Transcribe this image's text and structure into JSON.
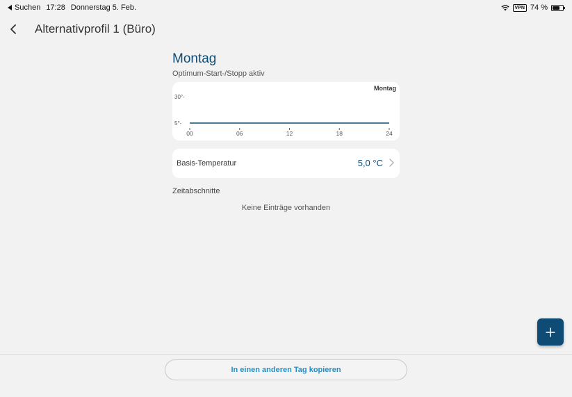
{
  "status_bar": {
    "back_app": "Suchen",
    "time": "17:28",
    "date": "Donnerstag 5. Feb.",
    "vpn": "VPN",
    "battery": "74 %",
    "battery_level": 0.74
  },
  "nav": {
    "title": "Alternativprofil 1 (Büro)",
    "back_icon": "chevron-left-icon"
  },
  "day": {
    "title": "Montag",
    "subtitle": "Optimum-Start-/Stopp aktiv"
  },
  "chart_data": {
    "type": "line",
    "title": "Montag",
    "y_ticks": [
      "30°-",
      "5°-"
    ],
    "y_tick_values": [
      30,
      5
    ],
    "x_ticks": [
      "00",
      "06",
      "12",
      "18",
      "24"
    ],
    "x_tick_values": [
      0,
      6,
      12,
      18,
      24
    ],
    "xlim": [
      0,
      24
    ],
    "ylim": [
      5,
      30
    ],
    "series": [
      {
        "x": [
          0,
          24
        ],
        "y": [
          5,
          5
        ]
      }
    ],
    "color": "#0f4c75"
  },
  "basis": {
    "label": "Basis-Temperatur",
    "value": "5,0 °C"
  },
  "sections": {
    "label": "Zeitabschnitte",
    "empty": "Keine Einträge vorhanden"
  },
  "fab": {
    "icon": "plus-icon"
  },
  "copy_button": {
    "label": "In einen anderen Tag kopieren"
  },
  "colors": {
    "accent": "#0f4c75",
    "link": "#2a8fbf",
    "background": "#f2f2f2"
  }
}
